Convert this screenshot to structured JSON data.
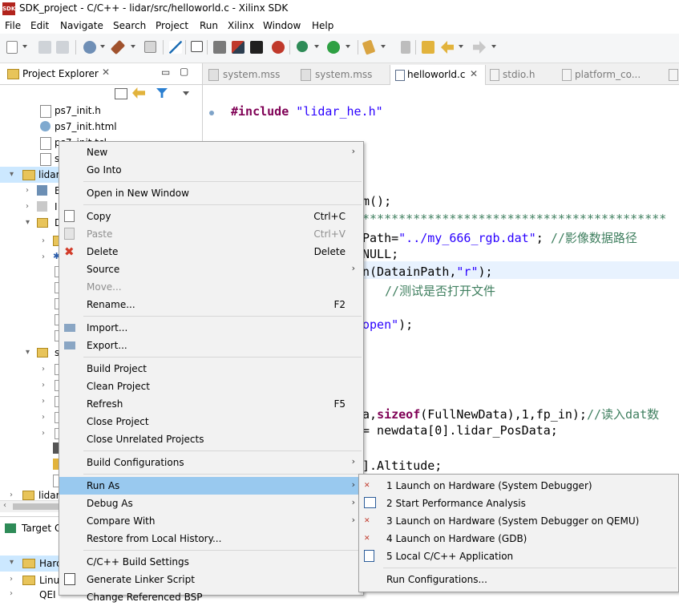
{
  "window": {
    "title": "SDK_project - C/C++ - lidar/src/helloworld.c - Xilinx SDK",
    "logo_text": "SDK"
  },
  "menubar": [
    "File",
    "Edit",
    "Navigate",
    "Search",
    "Project",
    "Run",
    "Xilinx",
    "Window",
    "Help"
  ],
  "project_explorer": {
    "tab_label": "Project Explorer",
    "tree": [
      {
        "label": "ps7_init.h"
      },
      {
        "label": "ps7_init.html"
      },
      {
        "label": "ps7_init.tcl"
      },
      {
        "label": "s"
      },
      {
        "label": "lidar"
      },
      {
        "label": "B"
      },
      {
        "label": "I"
      },
      {
        "label": "D"
      },
      {
        "label": "s"
      },
      {
        "label": "lidar"
      }
    ]
  },
  "bottom_panel": {
    "tab_label": "Target C",
    "items": [
      "Hard",
      "Linu",
      "QEI"
    ]
  },
  "editor": {
    "tabs": [
      "system.mss",
      "system.mss",
      "helloworld.c",
      "stdio.h",
      "platform_co..."
    ],
    "active_tab": "helloworld.c",
    "lines": [
      {
        "kw": "#include",
        "str": "\"lidar_he.h\""
      },
      {
        "text": "m();"
      },
      {
        "text": "******************************************"
      },
      {
        "text": "Path=",
        "str": "\"../my_666_rgb.dat\"",
        "rest": ";  ",
        "comment": "//影像数据路径"
      },
      {
        "text": "NULL;"
      },
      {
        "text": "n(DatainPath,",
        "str": "\"r\"",
        "rest": ");"
      },
      {
        "comment": "//测试是否打开文件"
      },
      {
        "str": "open\"",
        "rest": ");"
      },
      {
        "text": "a,",
        "kw": "sizeof",
        "rest": "(FullNewData),1,fp_in);",
        "comment": "//读入dat数"
      },
      {
        "text": "= newdata[0].lidar_PosData;"
      },
      {
        "text": "].Altitude;"
      }
    ]
  },
  "context_menu": {
    "items": [
      {
        "label": "New",
        "submenu": true
      },
      {
        "label": "Go Into"
      },
      {
        "sep": true
      },
      {
        "label": "Open in New Window"
      },
      {
        "sep": true
      },
      {
        "label": "Copy",
        "accel": "Ctrl+C",
        "icon": "copy-icon"
      },
      {
        "label": "Paste",
        "accel": "Ctrl+V",
        "disabled": true,
        "icon": "paste-icon"
      },
      {
        "label": "Delete",
        "accel": "Delete",
        "icon": "delete-icon"
      },
      {
        "label": "Source",
        "submenu": true
      },
      {
        "label": "Move...",
        "disabled": true
      },
      {
        "label": "Rename...",
        "accel": "F2"
      },
      {
        "sep": true
      },
      {
        "label": "Import...",
        "icon": "import-icon"
      },
      {
        "label": "Export...",
        "icon": "export-icon"
      },
      {
        "sep": true
      },
      {
        "label": "Build Project"
      },
      {
        "label": "Clean Project"
      },
      {
        "label": "Refresh",
        "accel": "F5"
      },
      {
        "label": "Close Project"
      },
      {
        "label": "Close Unrelated Projects"
      },
      {
        "sep": true
      },
      {
        "label": "Build Configurations",
        "submenu": true
      },
      {
        "sep": true
      },
      {
        "label": "Run As",
        "submenu": true,
        "highlighted": true
      },
      {
        "label": "Debug As",
        "submenu": true
      },
      {
        "label": "Compare With",
        "submenu": true
      },
      {
        "label": "Restore from Local History..."
      },
      {
        "sep": true
      },
      {
        "label": "C/C++ Build Settings"
      },
      {
        "label": "Generate Linker Script",
        "icon": "linker-script-icon"
      },
      {
        "label": "Change Referenced BSP"
      }
    ]
  },
  "run_as_menu": {
    "items": [
      {
        "label": "1 Launch on Hardware (System Debugger)",
        "icon": "tcf-launch-icon"
      },
      {
        "label": "2 Start Performance Analysis",
        "icon": "performance-icon"
      },
      {
        "label": "3 Launch on Hardware (System Debugger on QEMU)",
        "icon": "tcf-launch-icon"
      },
      {
        "label": "4 Launch on Hardware (GDB)",
        "icon": "gdb-launch-icon"
      },
      {
        "label": "5 Local C/C++ Application",
        "icon": "c-app-icon"
      },
      {
        "sep": true
      },
      {
        "label": "Run Configurations..."
      }
    ]
  },
  "colors": {
    "menu_highlight": "#99c9ef",
    "keyword": "#7f0055",
    "string": "#2a00ff",
    "comment": "#3f7f5f",
    "field": "#0000c0",
    "selection": "#cce8ff"
  }
}
